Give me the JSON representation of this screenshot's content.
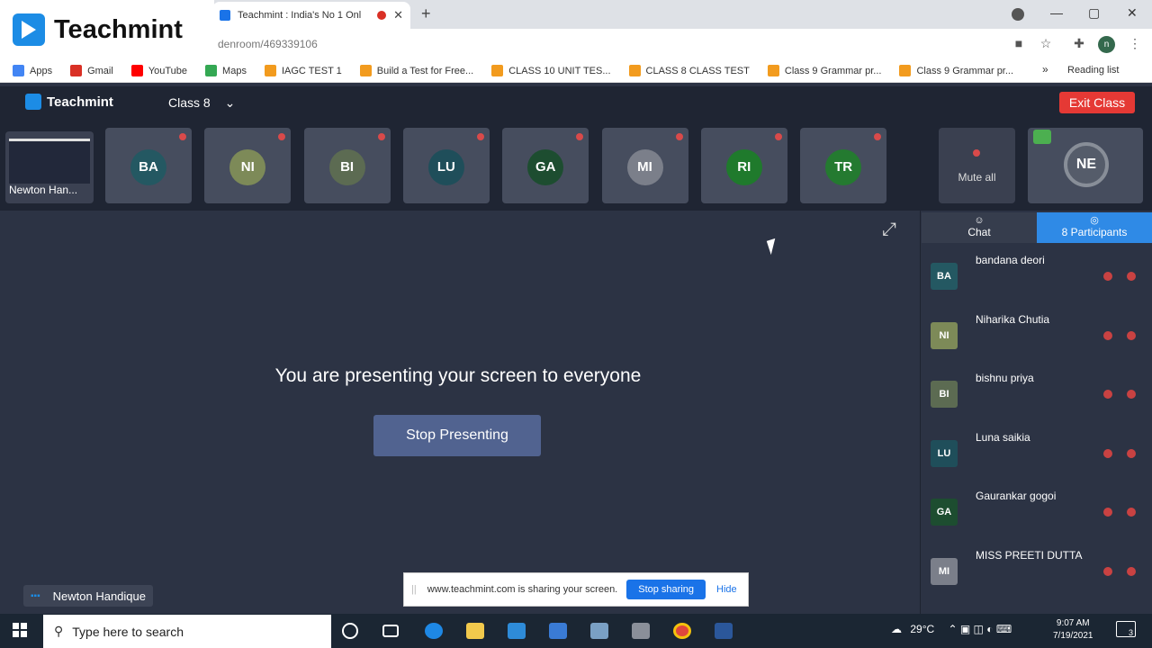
{
  "logo": {
    "text": "Teachmint"
  },
  "browser": {
    "tab_title": "Teachmint : India's No 1 Onl",
    "url": "denroom/469339106",
    "new_tab": "+",
    "tab_close": "✕",
    "bookmarks": [
      {
        "label": "Apps",
        "color": "#4285f4"
      },
      {
        "label": "Gmail",
        "color": "#d93025"
      },
      {
        "label": "YouTube",
        "color": "#ff0000"
      },
      {
        "label": "Maps",
        "color": "#34a853"
      },
      {
        "label": "IAGC TEST 1",
        "color": "#f29b1e"
      },
      {
        "label": "Build a Test for Free...",
        "color": "#f29b1e"
      },
      {
        "label": "CLASS 10 UNIT TES...",
        "color": "#f29b1e"
      },
      {
        "label": "CLASS 8 CLASS TEST",
        "color": "#f29b1e"
      },
      {
        "label": "Class 9 Grammar pr...",
        "color": "#f29b1e"
      },
      {
        "label": "Class 9 Grammar pr...",
        "color": "#f29b1e"
      }
    ],
    "reading_list": "Reading list",
    "profile_initial": "n"
  },
  "app": {
    "name": "Teachmint",
    "class_selector": "Class 8",
    "exit_label": "Exit Class"
  },
  "strip": {
    "self_name": "Newton Han...",
    "tiles": [
      {
        "initials": "BA",
        "color": "#245862"
      },
      {
        "initials": "NI",
        "color": "#7d8a58"
      },
      {
        "initials": "BI",
        "color": "#5c6b52"
      },
      {
        "initials": "LU",
        "color": "#1f4e5a"
      },
      {
        "initials": "GA",
        "color": "#1d4d30"
      },
      {
        "initials": "MI",
        "color": "#7b7f8a"
      },
      {
        "initials": "RI",
        "color": "#1f7a2c"
      },
      {
        "initials": "TR",
        "color": "#247a30"
      }
    ],
    "mute_all": "Mute all",
    "host_initials": "NE"
  },
  "main": {
    "presenting_message": "You are presenting your screen to everyone",
    "stop_presenting": "Stop Presenting",
    "self_label": "Newton Handique"
  },
  "panel": {
    "tab_chat": "Chat",
    "tab_participants": "8 Participants",
    "participants": [
      {
        "initials": "BA",
        "name": "bandana deori",
        "color": "#245862"
      },
      {
        "initials": "NI",
        "name": "Niharika Chutia",
        "color": "#7d8a58"
      },
      {
        "initials": "BI",
        "name": "bishnu priya",
        "color": "#5c6b52"
      },
      {
        "initials": "LU",
        "name": "Luna saikia",
        "color": "#1f4e5a"
      },
      {
        "initials": "GA",
        "name": "Gaurankar gogoi",
        "color": "#1d4d30"
      },
      {
        "initials": "MI",
        "name": "MISS PREETI DUTTA",
        "color": "#7b7f8a"
      }
    ]
  },
  "sharebar": {
    "message": "www.teachmint.com is sharing your screen.",
    "stop": "Stop sharing",
    "hide": "Hide"
  },
  "taskbar": {
    "search_placeholder": "Type here to search",
    "temperature": "29°C",
    "time": "9:07 AM",
    "date": "7/19/2021",
    "notifications": "3"
  }
}
